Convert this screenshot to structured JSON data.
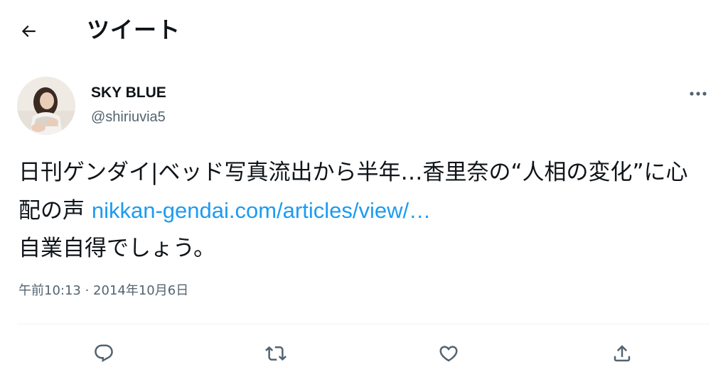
{
  "header": {
    "title": "ツイート",
    "back_icon": "arrow-left-icon"
  },
  "tweet": {
    "author": {
      "display_name": "SKY BLUE",
      "handle": "@shiriuvia5"
    },
    "text_before_link": "日刊ゲンダイ|ベッド写真流出から半年…香里奈の“人相の変化”に心配の声 ",
    "link": "nikkan-gendai.com/articles/view/…",
    "text_after_link": "\n自業自得でしょう。",
    "timestamp": "午前10:13 · 2014年10月6日"
  },
  "actions": {
    "icons": [
      "reply-icon",
      "retweet-icon",
      "like-icon",
      "share-icon"
    ]
  },
  "colors": {
    "text": "#0f1419",
    "secondary": "#536471",
    "link": "#1d9bf0",
    "divider": "#eff3f4"
  }
}
